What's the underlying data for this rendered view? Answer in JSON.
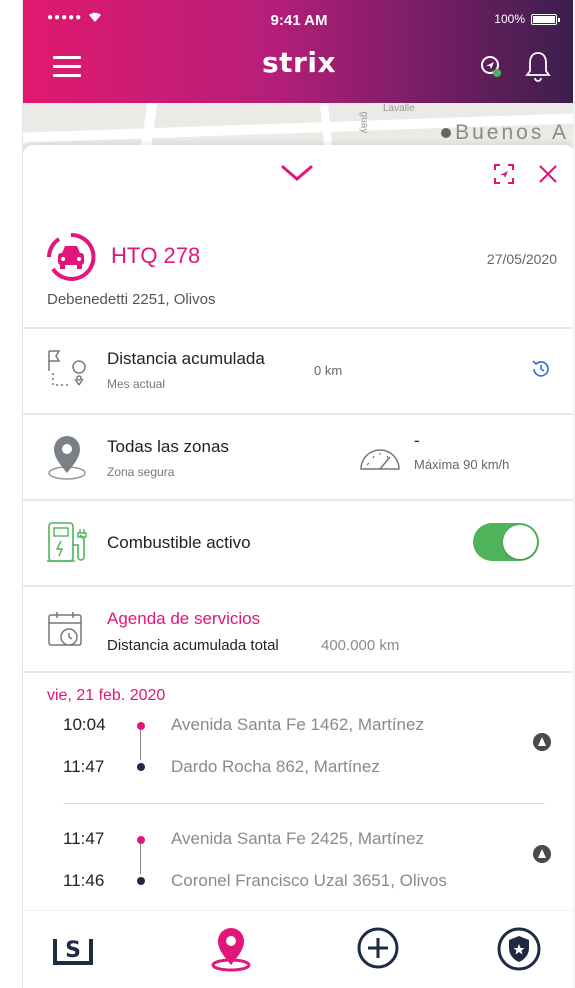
{
  "status_bar": {
    "signal": "●●●●●",
    "wifi": "wifi-icon",
    "time": "9:41 AM",
    "battery_pct": "100%"
  },
  "header": {
    "logo": "strix",
    "menu_icon": "hamburger-icon",
    "icons": [
      "route-icon",
      "bell-icon"
    ]
  },
  "map": {
    "label": "Buenos A",
    "road1": "Lavalle",
    "road2": "guay"
  },
  "sheet": {
    "vehicle": {
      "plate": "HTQ 278",
      "date": "27/05/2020",
      "address": "Debenedetti 2251, Olivos"
    },
    "distance": {
      "title": "Distancia acumulada",
      "subtitle": "Mes actual",
      "value": "0 km"
    },
    "zones": {
      "title": "Todas las zonas",
      "subtitle": "Zona segura",
      "speed_value": "-",
      "speed_label": "Máxima 90 km/h"
    },
    "fuel": {
      "title": "Combustible activo",
      "enabled": true
    },
    "services": {
      "title": "Agenda de servicios",
      "label": "Distancia acumulada total",
      "value": "400.000 km"
    }
  },
  "trips": {
    "date": "vie, 21 feb. 2020",
    "items": [
      {
        "start_time": "10:04",
        "start_addr": "Avenida Santa Fe 1462, Martínez",
        "end_time": "11:47",
        "end_addr": "Dardo Rocha 862, Martínez"
      },
      {
        "start_time": "11:47",
        "start_addr": "Avenida Santa Fe 2425, Martínez",
        "end_time": "11:46",
        "end_addr": "Coronel Francisco Uzal 3651, Olivos"
      }
    ]
  },
  "tabs": [
    "strix-home-icon",
    "location-pin-icon",
    "add-circle-icon",
    "shield-icon"
  ],
  "colors": {
    "accent": "#e2157a",
    "dark": "#1f2a44",
    "toggle_on": "#4fb35a"
  }
}
